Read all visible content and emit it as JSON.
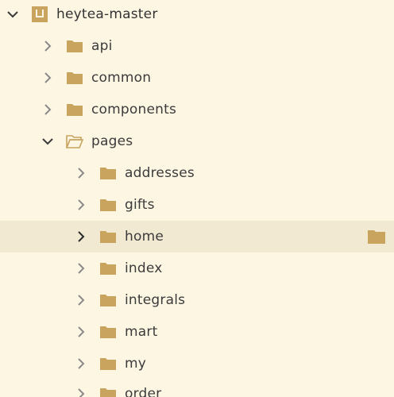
{
  "colors": {
    "background": "#fdf6e3",
    "selected_row": "#f1e9d2",
    "folder": "#c8a45f",
    "chevron": "#8a8a8a",
    "text": "#3b3b3b"
  },
  "tree": {
    "root": {
      "label": "heytea-master",
      "expanded": true,
      "icon": "project-icon"
    },
    "level1": [
      {
        "label": "api",
        "expanded": false
      },
      {
        "label": "common",
        "expanded": false
      },
      {
        "label": "components",
        "expanded": false
      },
      {
        "label": "pages",
        "expanded": true
      }
    ],
    "level2": [
      {
        "label": "addresses",
        "expanded": false
      },
      {
        "label": "gifts",
        "expanded": false
      },
      {
        "label": "home",
        "expanded": false,
        "selected": true
      },
      {
        "label": "index",
        "expanded": false
      },
      {
        "label": "integrals",
        "expanded": false
      },
      {
        "label": "mart",
        "expanded": false
      },
      {
        "label": "my",
        "expanded": false
      },
      {
        "label": "order",
        "expanded": false
      }
    ]
  }
}
